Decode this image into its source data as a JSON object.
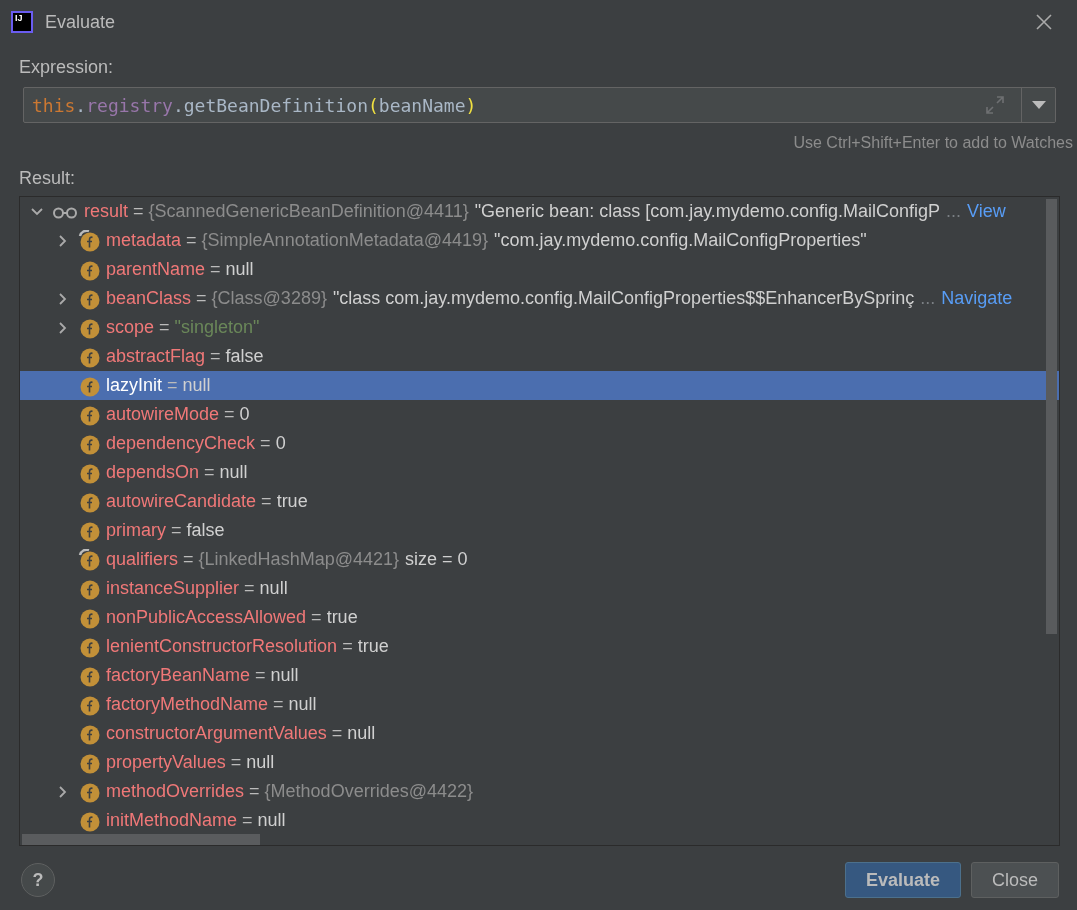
{
  "window": {
    "title": "Evaluate",
    "app_icon": "IJ"
  },
  "expression": {
    "label": "Expression:",
    "tokens": [
      {
        "text": "this",
        "kind": "keyword"
      },
      {
        "text": ".",
        "kind": "plain"
      },
      {
        "text": "registry",
        "kind": "field"
      },
      {
        "text": ".getBeanDefinition",
        "kind": "plain"
      },
      {
        "text": "(",
        "kind": "paren"
      },
      {
        "text": "beanName",
        "kind": "plain"
      },
      {
        "text": ")",
        "kind": "paren"
      }
    ],
    "hint": "Use Ctrl+Shift+Enter to add to Watches"
  },
  "result": {
    "label": "Result:",
    "tree": [
      {
        "kind": "watch",
        "name": "result",
        "operator": "=",
        "expandable": true,
        "expanded": true,
        "selected": false,
        "value": {
          "text": "{ScannedGenericBeanDefinition@4411}",
          "kind": "object"
        },
        "extra": "\"Generic bean: class [com.jay.mydemo.config.MailConfigP",
        "more": "...",
        "link": "View",
        "children": [
          {
            "kind": "field",
            "name": "metadata",
            "operator": "=",
            "final": true,
            "expandable": true,
            "expanded": false,
            "selected": false,
            "value": {
              "text": "{SimpleAnnotationMetadata@4419}",
              "kind": "object"
            },
            "extra": "\"com.jay.mydemo.config.MailConfigProperties\""
          },
          {
            "kind": "field",
            "name": "parentName",
            "operator": "=",
            "final": false,
            "expandable": false,
            "selected": false,
            "value": {
              "text": "null",
              "kind": "plain"
            }
          },
          {
            "kind": "field",
            "name": "beanClass",
            "operator": "=",
            "final": false,
            "expandable": true,
            "expanded": false,
            "selected": false,
            "value": {
              "text": "{Class@3289}",
              "kind": "object"
            },
            "extra": "\"class com.jay.mydemo.config.MailConfigProperties$$EnhancerBySprinç",
            "more": "...",
            "link": "Navigate"
          },
          {
            "kind": "field",
            "name": "scope",
            "operator": "=",
            "final": false,
            "expandable": true,
            "expanded": false,
            "selected": false,
            "value": {
              "text": "\"singleton\"",
              "kind": "string"
            }
          },
          {
            "kind": "field",
            "name": "abstractFlag",
            "operator": "=",
            "final": false,
            "expandable": false,
            "selected": false,
            "value": {
              "text": "false",
              "kind": "plain"
            }
          },
          {
            "kind": "field",
            "name": "lazyInit",
            "operator": "=",
            "final": false,
            "expandable": false,
            "selected": true,
            "value": {
              "text": "null",
              "kind": "plain"
            }
          },
          {
            "kind": "field",
            "name": "autowireMode",
            "operator": "=",
            "final": false,
            "expandable": false,
            "selected": false,
            "value": {
              "text": "0",
              "kind": "plain"
            }
          },
          {
            "kind": "field",
            "name": "dependencyCheck",
            "operator": "=",
            "final": false,
            "expandable": false,
            "selected": false,
            "value": {
              "text": "0",
              "kind": "plain"
            }
          },
          {
            "kind": "field",
            "name": "dependsOn",
            "operator": "=",
            "final": false,
            "expandable": false,
            "selected": false,
            "value": {
              "text": "null",
              "kind": "plain"
            }
          },
          {
            "kind": "field",
            "name": "autowireCandidate",
            "operator": "=",
            "final": false,
            "expandable": false,
            "selected": false,
            "value": {
              "text": "true",
              "kind": "plain"
            }
          },
          {
            "kind": "field",
            "name": "primary",
            "operator": "=",
            "final": false,
            "expandable": false,
            "selected": false,
            "value": {
              "text": "false",
              "kind": "plain"
            }
          },
          {
            "kind": "field",
            "name": "qualifiers",
            "operator": "=",
            "final": true,
            "expandable": false,
            "selected": false,
            "value": {
              "text": "{LinkedHashMap@4421}",
              "kind": "object"
            },
            "extra": "size = 0"
          },
          {
            "kind": "field",
            "name": "instanceSupplier",
            "operator": "=",
            "final": false,
            "expandable": false,
            "selected": false,
            "value": {
              "text": "null",
              "kind": "plain"
            }
          },
          {
            "kind": "field",
            "name": "nonPublicAccessAllowed",
            "operator": "=",
            "final": false,
            "expandable": false,
            "selected": false,
            "value": {
              "text": "true",
              "kind": "plain"
            }
          },
          {
            "kind": "field",
            "name": "lenientConstructorResolution",
            "operator": "=",
            "final": false,
            "expandable": false,
            "selected": false,
            "value": {
              "text": "true",
              "kind": "plain"
            }
          },
          {
            "kind": "field",
            "name": "factoryBeanName",
            "operator": "=",
            "final": false,
            "expandable": false,
            "selected": false,
            "value": {
              "text": "null",
              "kind": "plain"
            }
          },
          {
            "kind": "field",
            "name": "factoryMethodName",
            "operator": "=",
            "final": false,
            "expandable": false,
            "selected": false,
            "value": {
              "text": "null",
              "kind": "plain"
            }
          },
          {
            "kind": "field",
            "name": "constructorArgumentValues",
            "operator": "=",
            "final": false,
            "expandable": false,
            "selected": false,
            "value": {
              "text": "null",
              "kind": "plain"
            }
          },
          {
            "kind": "field",
            "name": "propertyValues",
            "operator": "=",
            "final": false,
            "expandable": false,
            "selected": false,
            "value": {
              "text": "null",
              "kind": "plain"
            }
          },
          {
            "kind": "field",
            "name": "methodOverrides",
            "operator": "=",
            "final": false,
            "expandable": true,
            "expanded": false,
            "selected": false,
            "value": {
              "text": "{MethodOverrides@4422}",
              "kind": "object"
            }
          },
          {
            "kind": "field",
            "name": "initMethodName",
            "operator": "=",
            "final": false,
            "expandable": false,
            "selected": false,
            "value": {
              "text": "null",
              "kind": "plain"
            }
          }
        ]
      }
    ]
  },
  "help": "?",
  "buttons": [
    {
      "label": "Evaluate",
      "kind": "primary"
    },
    {
      "label": "Close",
      "kind": "secondary"
    }
  ]
}
